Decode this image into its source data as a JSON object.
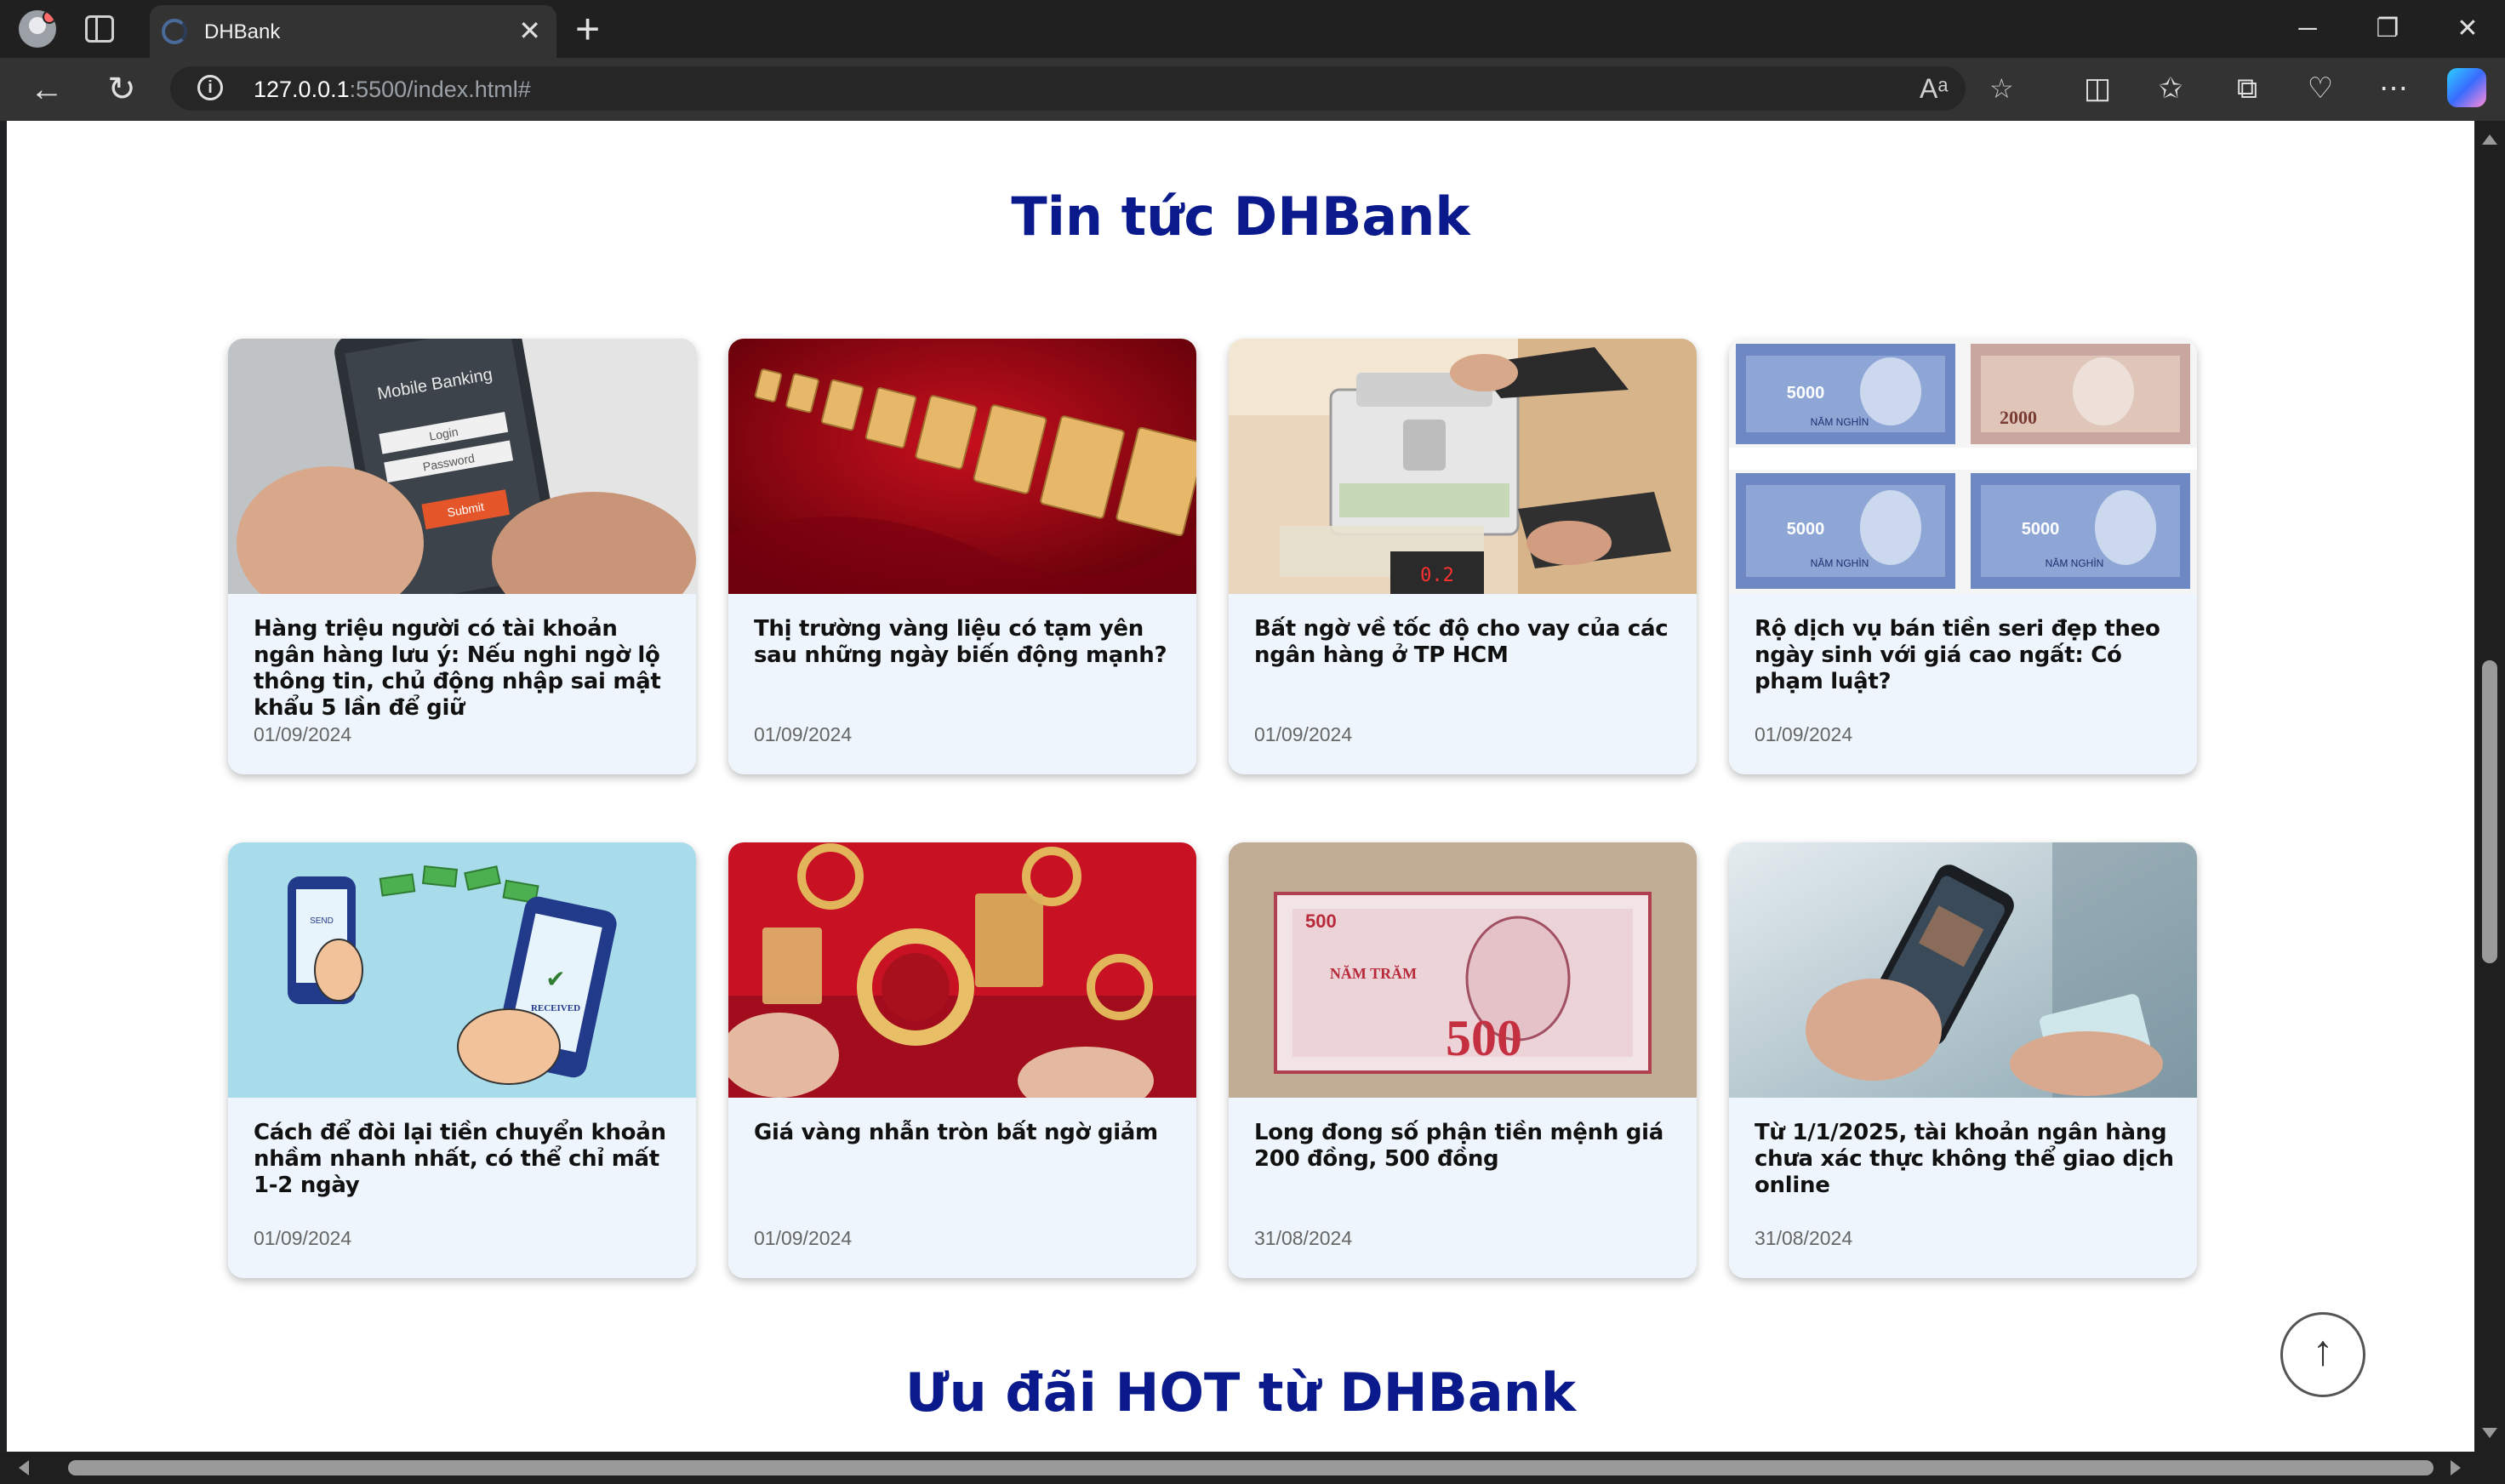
{
  "browser": {
    "tab_title": "DHBank",
    "url_host": "127.0.0.1",
    "url_rest": ":5500/index.html#"
  },
  "page": {
    "news_heading": "Tin tức DHBank",
    "promo_heading": "Ưu đãi HOT từ DHBank",
    "news": [
      {
        "headline": "Hàng triệu người có tài khoản ngân hàng lưu ý: Nếu nghi ngờ lộ thông tin, chủ động nhập sai mật khẩu 5 lần để giữ",
        "date": "01/09/2024",
        "image": "mobile-banking-phone"
      },
      {
        "headline": "Thị trường vàng liệu có tạm yên sau những ngày biến động mạnh?",
        "date": "01/09/2024",
        "image": "gold-bars-red-cloth"
      },
      {
        "headline": "Bất ngờ về tốc độ cho vay của các ngân hàng ở TP HCM",
        "date": "01/09/2024",
        "image": "money-counting-machine"
      },
      {
        "headline": "Rộ dịch vụ bán tiền seri đẹp theo ngày sinh với giá cao ngất: Có phạm luật?",
        "date": "01/09/2024",
        "image": "5000-dong-banknotes"
      },
      {
        "headline": "Cách để đòi lại tiền chuyển khoản nhầm nhanh nhất, có thể chỉ mất 1-2 ngày",
        "date": "01/09/2024",
        "image": "money-transfer-illustration"
      },
      {
        "headline": "Giá vàng nhẫn tròn bất ngờ giảm",
        "date": "01/09/2024",
        "image": "gold-rings"
      },
      {
        "headline": "Long đong số phận tiền mệnh giá 200 đồng, 500 đồng",
        "date": "31/08/2024",
        "image": "500-dong-banknote"
      },
      {
        "headline": "Từ 1/1/2025, tài khoản ngân hàng chưa xác thực không thể giao dịch online",
        "date": "31/08/2024",
        "image": "phone-id-card"
      }
    ],
    "image_text": {
      "mobile_banking": "Mobile Banking",
      "login": "Login",
      "password": "Password",
      "submit": "Submit",
      "send": "SEND",
      "received": "RECEIVED",
      "note_5000": "5000",
      "note_500": "500",
      "nam_nghin": "NĂM NGHÌN",
      "nam_tram": "NĂM TRĂM"
    }
  }
}
